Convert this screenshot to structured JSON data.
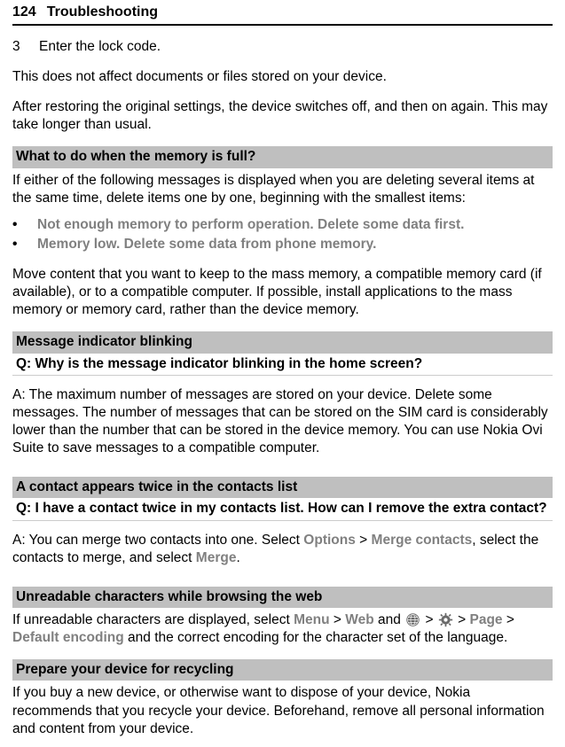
{
  "header": {
    "page_number": "124",
    "chapter": "Troubleshooting"
  },
  "step3": {
    "num": "3",
    "text": "Enter the lock code."
  },
  "intro_p1": "This does not affect documents or files stored on your device.",
  "intro_p2": "After restoring the original settings, the device switches off, and then on again. This may take longer than usual.",
  "memory_full": {
    "heading": "What to do when the memory is full?",
    "p1": "If either of the following messages is displayed when you are deleting several items at the same time, delete items one by one, beginning with the smallest items:",
    "bullet1": "Not enough memory to perform operation. Delete some data first.",
    "bullet2": "Memory low. Delete some data from phone memory.",
    "p2": "Move content that you want to keep to the mass memory, a compatible memory card (if available), or to a compatible computer. If possible, install applications to the mass memory or memory card, rather than the device memory."
  },
  "msg_indicator": {
    "heading": "Message indicator blinking",
    "q": "Q: Why is the message indicator blinking in the home screen?",
    "a": "A: The maximum number of messages are stored on your device. Delete some messages. The number of messages that can be stored on the SIM card is considerably lower than the number that can be stored in the device memory. You can use Nokia Ovi Suite to save messages to a compatible computer."
  },
  "contact_twice": {
    "heading": "A contact appears twice in the contacts list",
    "q": "Q: I have a contact twice in my contacts list. How can I remove the extra contact?",
    "a_pre": "A: You can merge two contacts into one. Select ",
    "options": "Options",
    "gt1": " > ",
    "merge_contacts": "Merge contacts",
    "a_mid": ", select the contacts to merge, and select ",
    "merge": "Merge",
    "a_end": "."
  },
  "unreadable": {
    "heading": "Unreadable characters while browsing the web",
    "pre": "If unreadable characters are displayed, select ",
    "menu": "Menu",
    "gt1": " > ",
    "web": "Web",
    "and": " and ",
    "gt2": " > ",
    "gt3": " > ",
    "page": "Page",
    "gt4": " > ",
    "default_encoding": "Default encoding",
    "post": " and the correct encoding for the character set of the language."
  },
  "recycling": {
    "heading": "Prepare your device for recycling",
    "p": "If you buy a new device, or otherwise want to dispose of your device, Nokia recommends that you recycle your device. Beforehand, remove all personal information and content from your device."
  }
}
